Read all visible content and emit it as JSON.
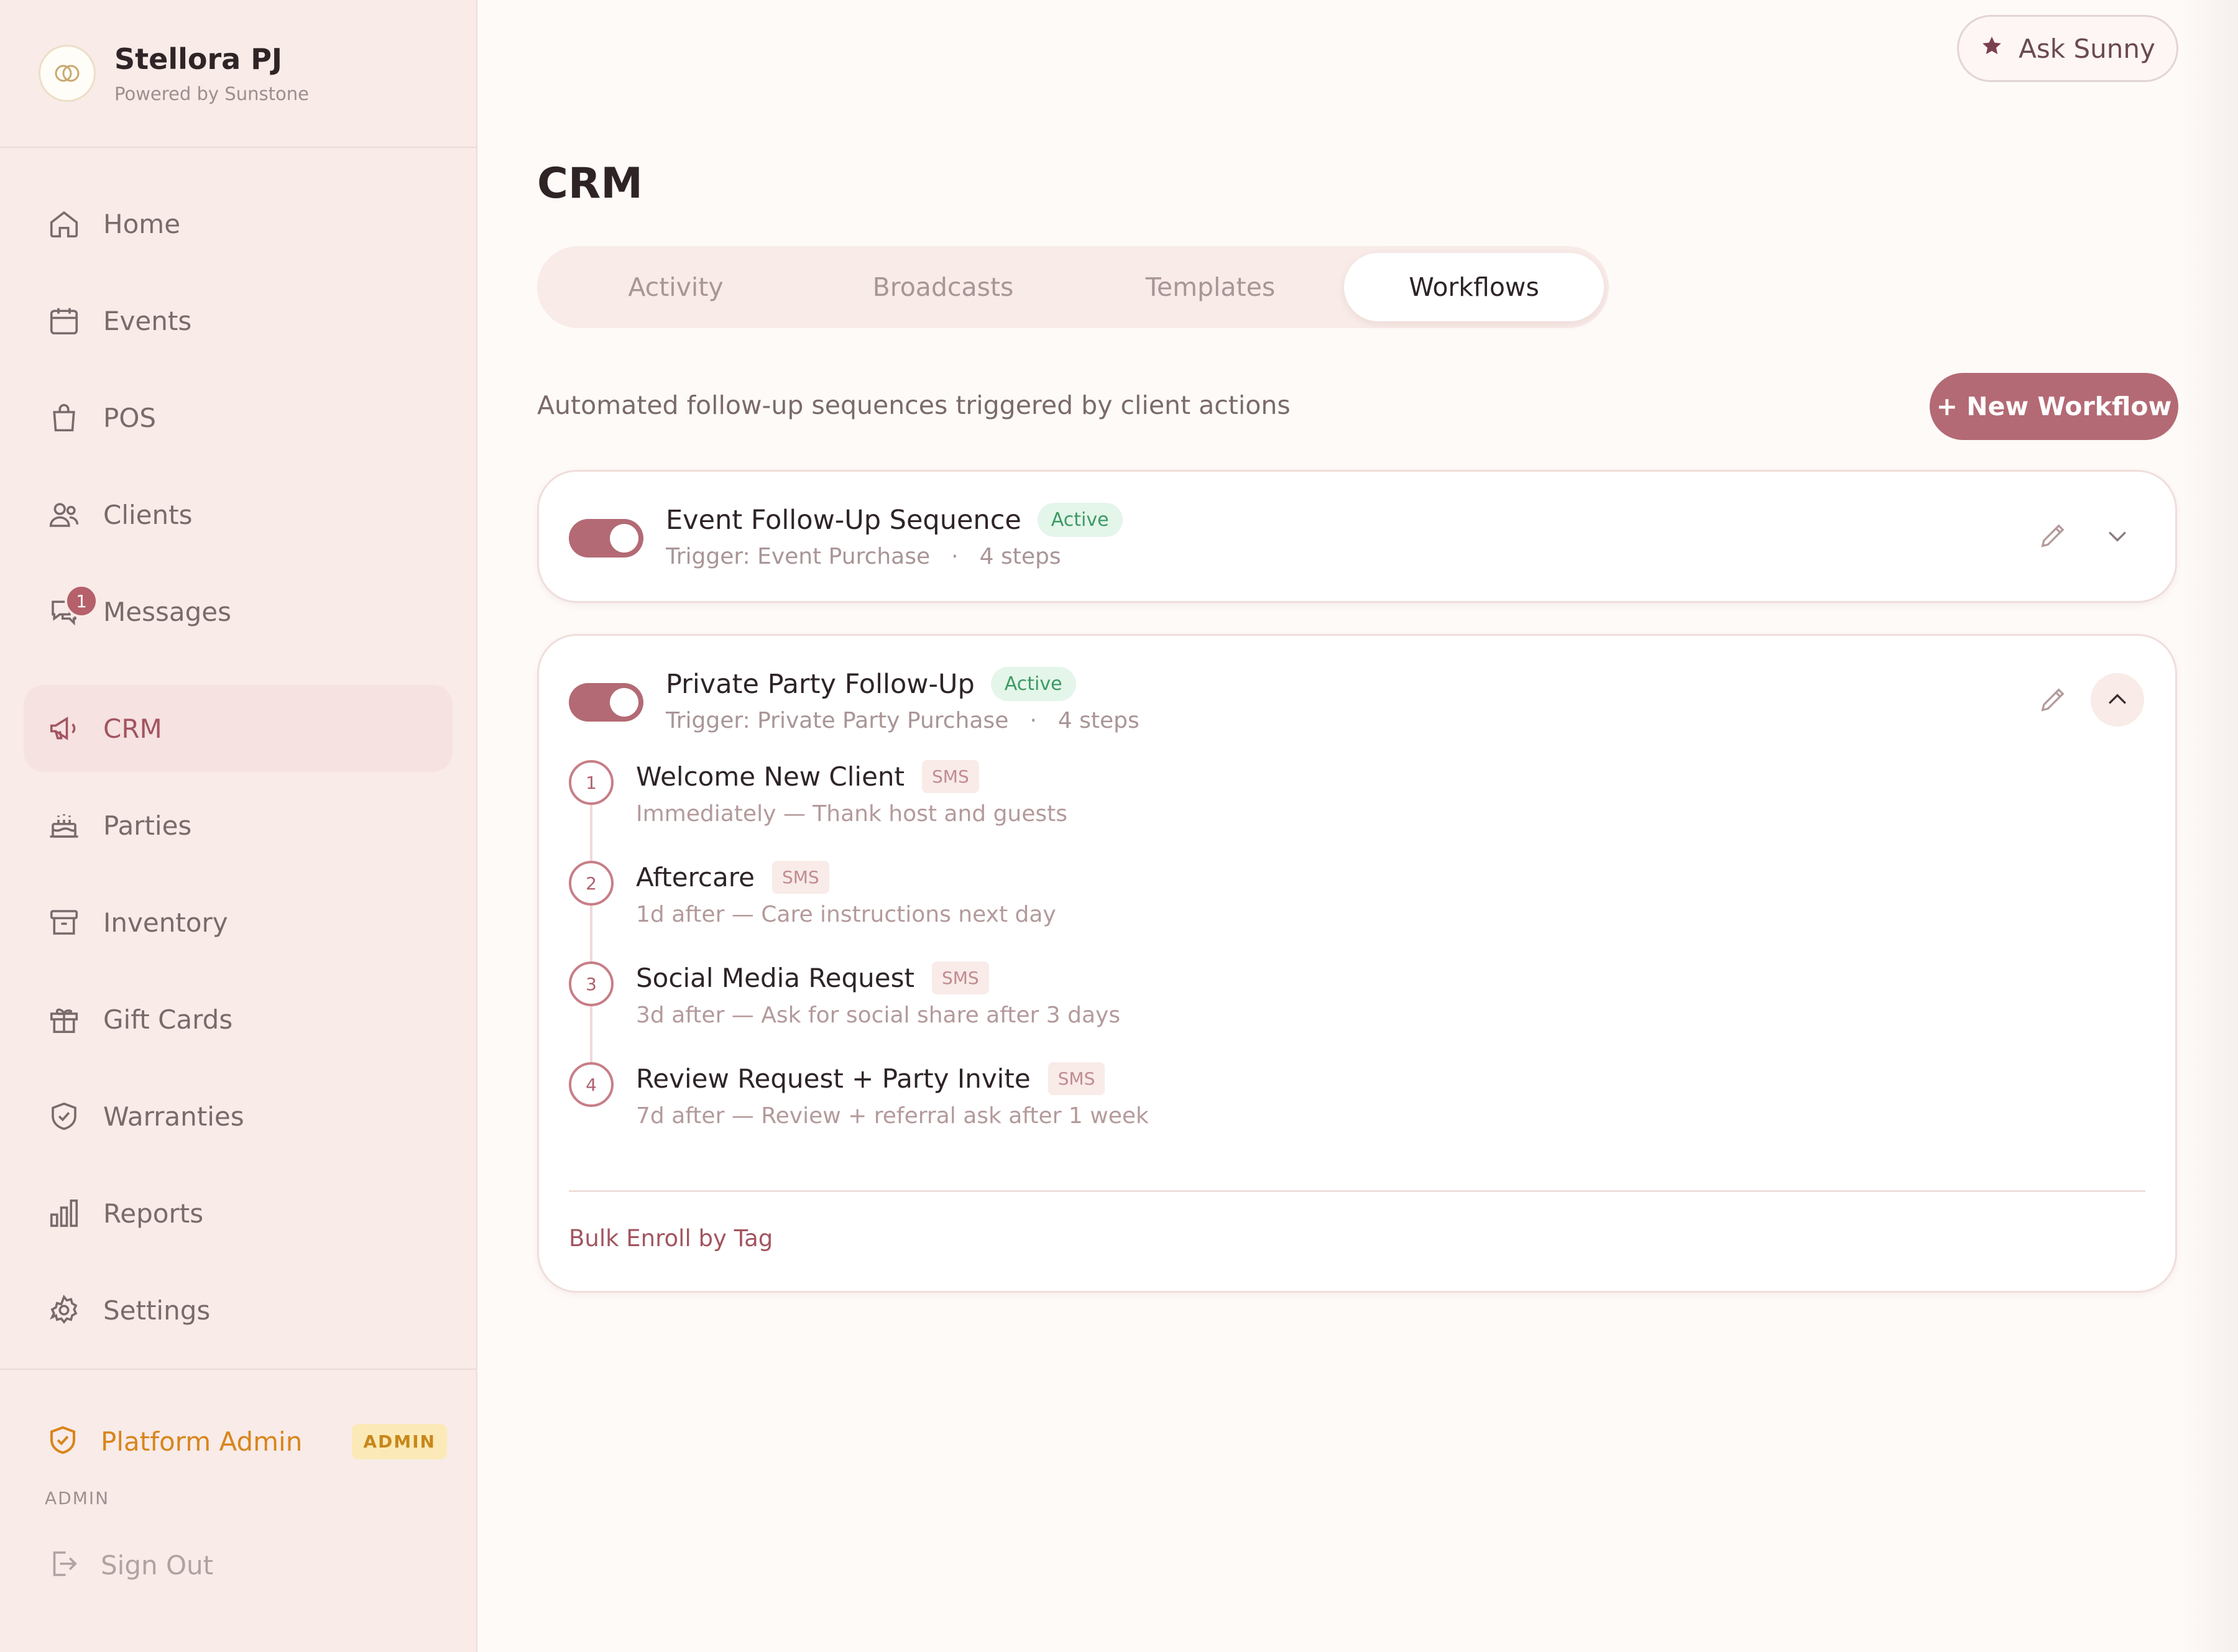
{
  "brand": {
    "name": "Stellora PJ",
    "subtitle": "Powered by Sunstone"
  },
  "sidebar": {
    "items": [
      {
        "label": "Home",
        "icon": "home-icon"
      },
      {
        "label": "Events",
        "icon": "calendar-icon"
      },
      {
        "label": "POS",
        "icon": "shopping-bag-icon"
      },
      {
        "label": "Clients",
        "icon": "users-icon"
      },
      {
        "label": "Messages",
        "icon": "chat-icon",
        "badge": "1"
      },
      {
        "label": "CRM",
        "icon": "megaphone-icon",
        "active": true
      },
      {
        "label": "Parties",
        "icon": "cake-icon"
      },
      {
        "label": "Inventory",
        "icon": "archive-icon"
      },
      {
        "label": "Gift Cards",
        "icon": "gift-icon"
      },
      {
        "label": "Warranties",
        "icon": "shield-icon"
      },
      {
        "label": "Reports",
        "icon": "bar-chart-icon"
      },
      {
        "label": "Settings",
        "icon": "gear-icon"
      }
    ],
    "admin": {
      "label": "Platform Admin",
      "tag": "ADMIN",
      "caption": "ADMIN"
    },
    "signout": "Sign Out"
  },
  "header": {
    "ask_label": "Ask Sunny"
  },
  "page": {
    "title": "CRM",
    "tabs": [
      "Activity",
      "Broadcasts",
      "Templates",
      "Workflows"
    ],
    "active_tab": "Workflows",
    "subtitle": "Automated follow-up sequences triggered by client actions",
    "new_button": "+ New Workflow"
  },
  "workflows": [
    {
      "title": "Event Follow-Up Sequence",
      "status": "Active",
      "trigger": "Trigger: Event Purchase",
      "separator": "·",
      "steps_count": "4 steps",
      "enabled": true,
      "expanded": false
    },
    {
      "title": "Private Party Follow-Up",
      "status": "Active",
      "trigger": "Trigger: Private Party Purchase",
      "separator": "·",
      "steps_count": "4 steps",
      "enabled": true,
      "expanded": true,
      "steps": [
        {
          "num": "1",
          "name": "Welcome New Client",
          "channel": "SMS",
          "desc": "Immediately — Thank host and guests"
        },
        {
          "num": "2",
          "name": "Aftercare",
          "channel": "SMS",
          "desc": "1d after — Care instructions next day"
        },
        {
          "num": "3",
          "name": "Social Media Request",
          "channel": "SMS",
          "desc": "3d after — Ask for social share after 3 days"
        },
        {
          "num": "4",
          "name": "Review Request + Party Invite",
          "channel": "SMS",
          "desc": "7d after — Review + referral ask after 1 week"
        }
      ],
      "bulk_link": "Bulk Enroll by Tag"
    }
  ],
  "colors": {
    "accent": "#b36a74",
    "sidebar_bg": "#f8ebe8",
    "active_green": "#3b9a63",
    "admin_orange": "#d8851b"
  }
}
